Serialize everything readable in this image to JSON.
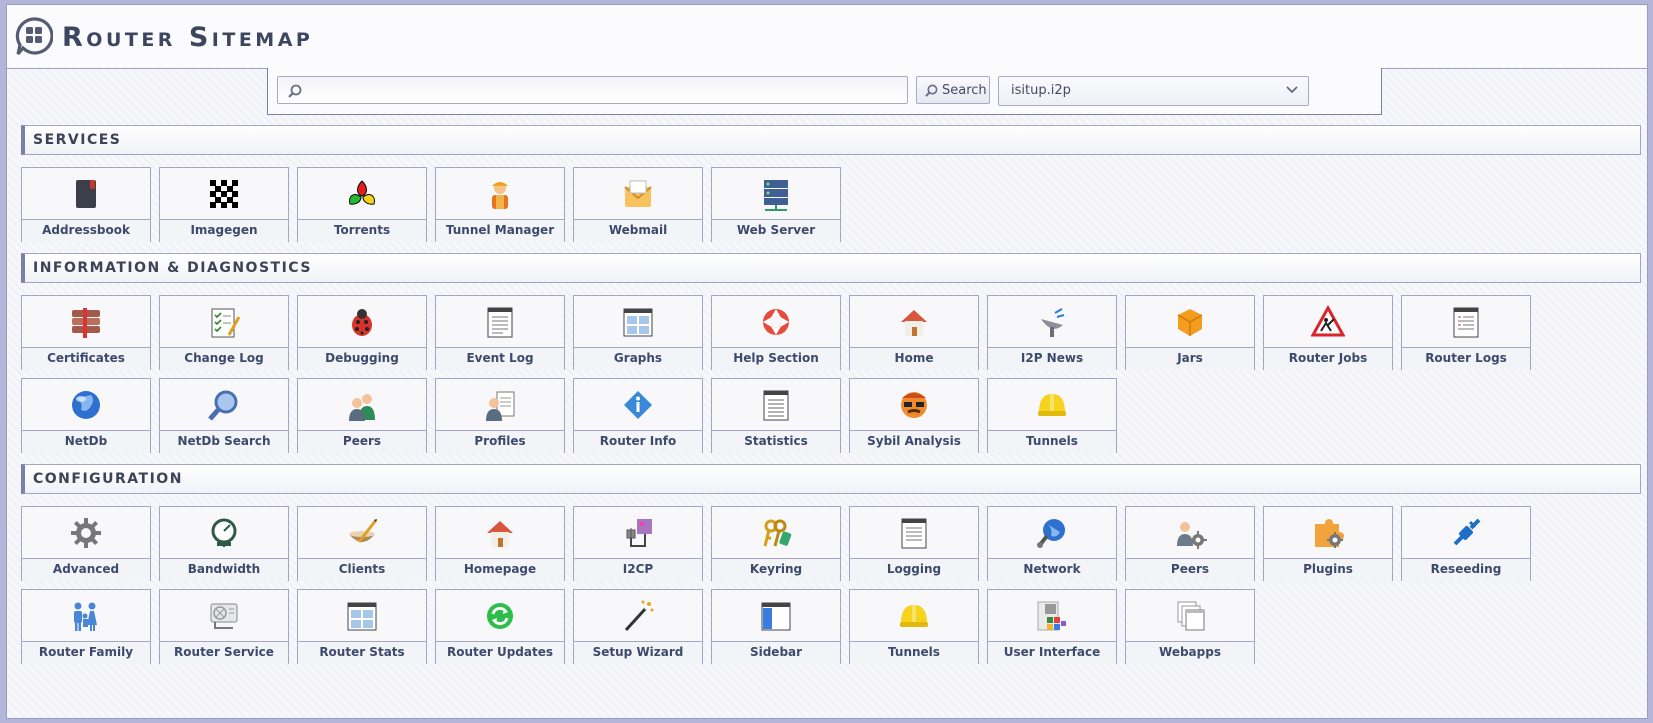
{
  "header": {
    "title": "Router Sitemap"
  },
  "search": {
    "placeholder": "",
    "value": "",
    "button_label": "Search",
    "engine": "isitup.i2p"
  },
  "sections": {
    "services": {
      "title": "SERVICES",
      "items": [
        {
          "label": "Addressbook",
          "icon": "addressbook-icon"
        },
        {
          "label": "Imagegen",
          "icon": "imagegen-icon"
        },
        {
          "label": "Torrents",
          "icon": "torrents-icon"
        },
        {
          "label": "Tunnel Manager",
          "icon": "tunnel-manager-icon"
        },
        {
          "label": "Webmail",
          "icon": "webmail-icon"
        },
        {
          "label": "Web Server",
          "icon": "web-server-icon"
        }
      ]
    },
    "info": {
      "title": "INFORMATION & DIAGNOSTICS",
      "items": [
        {
          "label": "Certificates",
          "icon": "certificates-icon"
        },
        {
          "label": "Change Log",
          "icon": "change-log-icon"
        },
        {
          "label": "Debugging",
          "icon": "debugging-icon"
        },
        {
          "label": "Event Log",
          "icon": "event-log-icon"
        },
        {
          "label": "Graphs",
          "icon": "graphs-icon"
        },
        {
          "label": "Help Section",
          "icon": "help-icon"
        },
        {
          "label": "Home",
          "icon": "home-icon"
        },
        {
          "label": "I2P News",
          "icon": "news-icon"
        },
        {
          "label": "Jars",
          "icon": "jars-icon"
        },
        {
          "label": "Router Jobs",
          "icon": "router-jobs-icon"
        },
        {
          "label": "Router Logs",
          "icon": "router-logs-icon"
        },
        {
          "label": "NetDb",
          "icon": "netdb-icon"
        },
        {
          "label": "NetDb Search",
          "icon": "netdb-search-icon"
        },
        {
          "label": "Peers",
          "icon": "peers-icon"
        },
        {
          "label": "Profiles",
          "icon": "profiles-icon"
        },
        {
          "label": "Router Info",
          "icon": "router-info-icon"
        },
        {
          "label": "Statistics",
          "icon": "statistics-icon"
        },
        {
          "label": "Sybil Analysis",
          "icon": "sybil-icon"
        },
        {
          "label": "Tunnels",
          "icon": "tunnels-icon"
        }
      ]
    },
    "config": {
      "title": "CONFIGURATION",
      "items": [
        {
          "label": "Advanced",
          "icon": "gear-icon"
        },
        {
          "label": "Bandwidth",
          "icon": "bandwidth-icon"
        },
        {
          "label": "Clients",
          "icon": "clients-icon"
        },
        {
          "label": "Homepage",
          "icon": "homepage-icon"
        },
        {
          "label": "I2CP",
          "icon": "i2cp-icon"
        },
        {
          "label": "Keyring",
          "icon": "keyring-icon"
        },
        {
          "label": "Logging",
          "icon": "logging-icon"
        },
        {
          "label": "Network",
          "icon": "network-icon"
        },
        {
          "label": "Peers",
          "icon": "peers-config-icon"
        },
        {
          "label": "Plugins",
          "icon": "plugins-icon"
        },
        {
          "label": "Reseeding",
          "icon": "reseeding-icon"
        },
        {
          "label": "Router Family",
          "icon": "family-icon"
        },
        {
          "label": "Router Service",
          "icon": "service-icon"
        },
        {
          "label": "Router Stats",
          "icon": "router-stats-icon"
        },
        {
          "label": "Router Updates",
          "icon": "updates-icon"
        },
        {
          "label": "Setup Wizard",
          "icon": "wizard-icon"
        },
        {
          "label": "Sidebar",
          "icon": "sidebar-icon"
        },
        {
          "label": "Tunnels",
          "icon": "tunnels-config-icon"
        },
        {
          "label": "User Interface",
          "icon": "ui-icon"
        },
        {
          "label": "Webapps",
          "icon": "webapps-icon"
        }
      ]
    }
  }
}
